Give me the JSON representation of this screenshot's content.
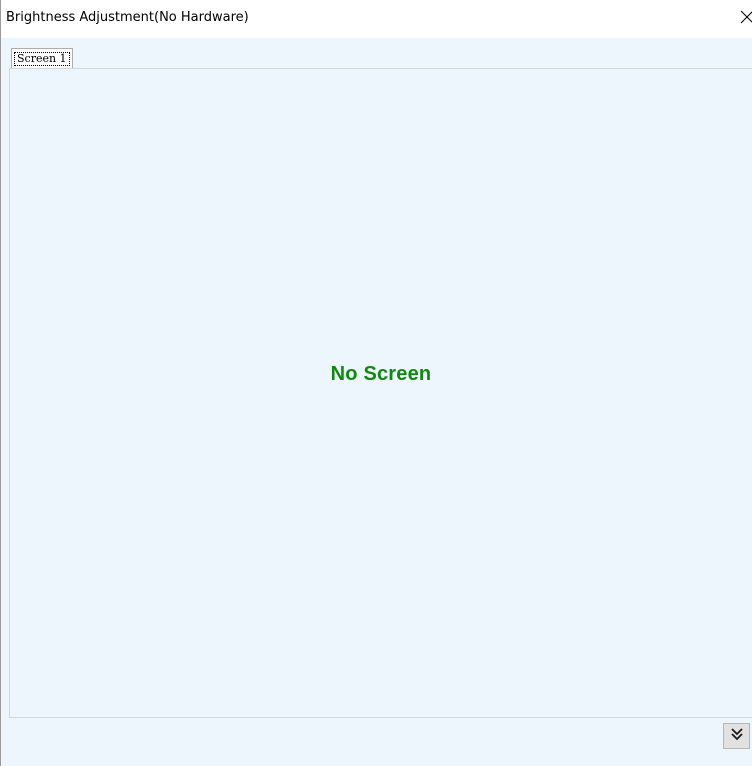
{
  "window": {
    "title": "Brightness Adjustment(No Hardware)",
    "close_icon": "close-icon"
  },
  "tabs": [
    {
      "label": "Screen 1",
      "selected": true
    }
  ],
  "panel": {
    "empty_message": "No Screen",
    "empty_message_color": "#0f8a0f"
  },
  "footer": {
    "expand_icon": "double-chevron-down-icon"
  },
  "colors": {
    "client_background": "#edf5fd",
    "title_background": "#ffffff"
  }
}
